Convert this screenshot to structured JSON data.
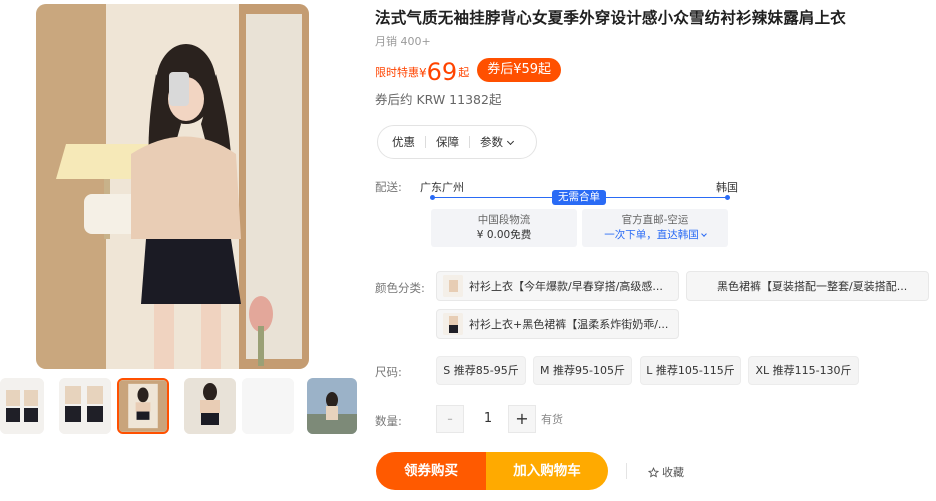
{
  "product": {
    "title": "法式气质无袖挂脖背心女夏季外穿设计感小众雪纺衬衫辣妹露肩上衣",
    "monthly_sales": "月销 400+",
    "price_label": "限时特惠",
    "currency": "¥",
    "price": "69",
    "price_suffix": "起",
    "coupon_price": "券后¥59起",
    "krw_price": "券后约 KRW 11382起"
  },
  "info_tabs": [
    {
      "label": "优惠"
    },
    {
      "label": "保障"
    },
    {
      "label": "参数"
    }
  ],
  "shipping": {
    "label": "配送:",
    "from": "广东广州",
    "to": "韩国",
    "badge": "无需合单",
    "domestic_title": "中国段物流",
    "domestic_value": "¥ 0.00免费",
    "intl_title": "官方直邮-空运",
    "intl_value": "一次下单，直达韩国"
  },
  "color": {
    "label": "颜色分类:",
    "options": [
      "衬衫上衣【今年爆款/早春穿搭/高级感...",
      "黑色裙裤【夏装搭配一整套/夏装搭配...",
      "衬衫上衣+黑色裙裤【温柔系炸街奶乖/..."
    ]
  },
  "size": {
    "label": "尺码:",
    "options": [
      "S 推荐85-95斤",
      "M 推荐95-105斤",
      "L 推荐105-115斤",
      "XL 推荐115-130斤"
    ]
  },
  "quantity": {
    "label": "数量:",
    "minus": "-",
    "value": "1",
    "plus": "+",
    "stock": "有货"
  },
  "actions": {
    "buy": "领券购买",
    "cart": "加入购物车",
    "favorite": "收藏"
  },
  "colors": {
    "accent": "#ff5000",
    "cart": "#ffaa00",
    "link_blue": "#2a6bf5"
  }
}
